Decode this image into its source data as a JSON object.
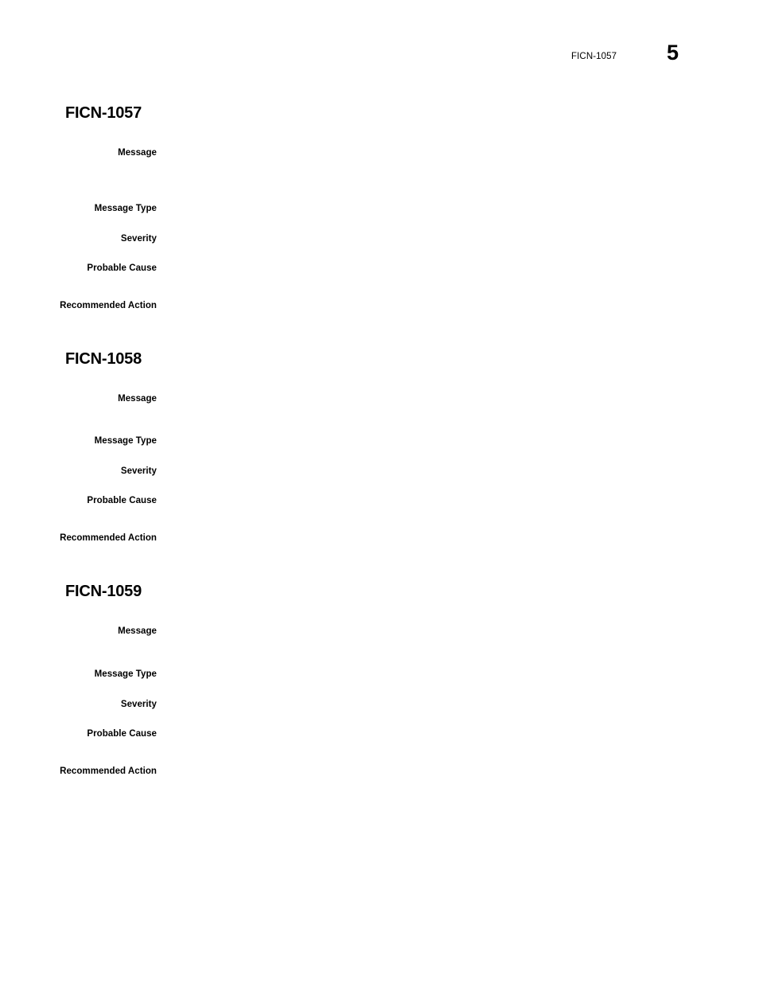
{
  "document": {
    "page_header": {
      "reference": "FICN-1057",
      "page_number": "5"
    }
  },
  "labels": {
    "message": "Message",
    "message_type": "Message Type",
    "severity": "Severity",
    "probable_cause": "Probable Cause",
    "recommended_action": "Recommended\nAction"
  },
  "entries": [
    {
      "title": "FICN-1057",
      "fields": [
        {
          "label": "Message",
          "value": ""
        },
        {
          "label": "Message Type",
          "value": ""
        },
        {
          "label": "Severity",
          "value": ""
        },
        {
          "label": "Probable Cause",
          "value": ""
        },
        {
          "label": "Recommended\nAction",
          "value": ""
        }
      ]
    },
    {
      "title": "FICN-1058",
      "fields": [
        {
          "label": "Message",
          "value": ""
        },
        {
          "label": "Message Type",
          "value": ""
        },
        {
          "label": "Severity",
          "value": ""
        },
        {
          "label": "Probable Cause",
          "value": ""
        },
        {
          "label": "Recommended\nAction",
          "value": ""
        }
      ]
    },
    {
      "title": "FICN-1059",
      "fields": [
        {
          "label": "Message",
          "value": ""
        },
        {
          "label": "Message Type",
          "value": ""
        },
        {
          "label": "Severity",
          "value": ""
        },
        {
          "label": "Probable Cause",
          "value": ""
        },
        {
          "label": "Recommended\nAction",
          "value": ""
        }
      ]
    }
  ],
  "layout": {
    "entry_tops": [
      131,
      440,
      732
    ],
    "field_tops": [
      [
        52,
        122,
        160,
        197,
        244
      ],
      [
        52,
        105,
        143,
        180,
        227
      ],
      [
        52,
        106,
        144,
        181,
        228
      ]
    ]
  }
}
